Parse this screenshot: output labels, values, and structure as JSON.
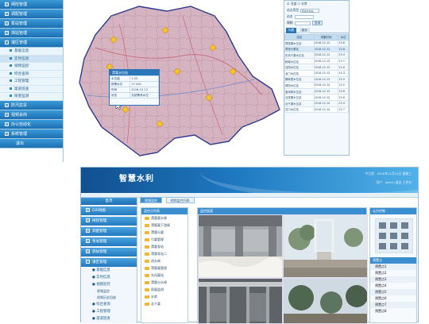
{
  "sidebar_top": {
    "items": [
      {
        "label": "闸控管理",
        "expanded": false
      },
      {
        "label": "调配管理",
        "expanded": false
      },
      {
        "label": "泵站管理",
        "expanded": false
      },
      {
        "label": "测站管理",
        "expanded": false
      },
      {
        "label": "灌区管理",
        "expanded": true
      }
    ],
    "subitems": [
      {
        "label": "基础信息",
        "selected": false
      },
      {
        "label": "实时信息",
        "selected": true
      },
      {
        "label": "视频监控",
        "selected": false
      },
      {
        "label": "综合查询",
        "selected": false
      },
      {
        "label": "工程管理",
        "selected": false
      },
      {
        "label": "渠道巡查",
        "selected": false
      },
      {
        "label": "隐患监测",
        "selected": false
      }
    ],
    "items_after": [
      {
        "label": "防汛抗旱"
      },
      {
        "label": "视频会商"
      },
      {
        "label": "办公自动化"
      },
      {
        "label": "系统管理"
      }
    ],
    "footer": "退出"
  },
  "map_popup": {
    "title": "渭惠水位站",
    "rows": [
      [
        "水位值",
        "1.25"
      ],
      [
        "报警水位",
        "17.200"
      ],
      [
        "时间",
        "2016-12-12"
      ],
      [
        "状态",
        "无超警戒水位"
      ]
    ]
  },
  "query_panel": {
    "checkbox_a": "河道",
    "checkbox_b": "水库",
    "row1_label": "站点类型",
    "row1_value": "河道水位站",
    "row2_label": "站名",
    "row2_value": "",
    "row3_label": "模糊",
    "button_search": "查询",
    "tabs": [
      "列表",
      "统计"
    ],
    "columns": [
      "站名",
      "采集时间",
      "水位"
    ],
    "rows": [
      [
        "渭惠渠水位站",
        "2016-12-12",
        "15.6"
      ],
      [
        "渭惠分渠站",
        "2016-12-12",
        "15.8"
      ],
      [
        "东风干渠水位站",
        "2016-12-12",
        "15.4"
      ],
      [
        "韩城水位站",
        "2016-12-12",
        "15.7"
      ],
      [
        "泾阳水位站",
        "2016-12-12",
        "15.6"
      ],
      [
        "龙门水位站",
        "2016-12-12",
        "15.3"
      ],
      [
        "魏家堡水位站",
        "2016-12-12",
        "15.9"
      ],
      [
        "咸阳水位站",
        "2016-12-12",
        "15.5"
      ],
      [
        "宝鸡峡水位站",
        "2016-12-12",
        "15.6"
      ],
      [
        "泾惠渠水位站",
        "2016-12-12",
        "15.8"
      ],
      [
        "北干渠水位站",
        "2016-12-12",
        "15.4"
      ],
      [
        "交口水位站",
        "2016-12-12",
        "15.7"
      ]
    ]
  },
  "app2": {
    "title": "智慧水利",
    "meta1": "今日是：2016年11月22日 星期三",
    "meta2": "用户：admin   退出   工作台",
    "nav_title": "首页",
    "nav_items": [
      {
        "label": "GIS地图"
      },
      {
        "label": "闸控管理"
      },
      {
        "label": "调配管理"
      },
      {
        "label": "泵站管理"
      },
      {
        "label": "测站管理"
      },
      {
        "label": "灌区管理",
        "expanded": true
      }
    ],
    "nav_subitems": [
      "基础信息",
      "实时信息",
      "视频监控"
    ],
    "nav_leaf": [
      "视频监控",
      "视频历史回放"
    ],
    "nav_items_after": [
      {
        "label": "综合查询"
      },
      {
        "label": "工程管理"
      },
      {
        "label": "渠道巡查"
      }
    ],
    "content_tabs": [
      "视频监控",
      "视频监控列表"
    ],
    "tree_title": "监控点列表",
    "tree_nodes": [
      "渭惠渠水闸",
      "渭惠渠下游闸",
      "渭惠分渠",
      "引渠管理",
      "渭惠泵站",
      "渭惠泵站二",
      "进水闸",
      "渭惠渠管理",
      "东风渠站",
      "渭惠分水闸",
      "雨量监测",
      "水库",
      "北干渠"
    ],
    "video_title": "监控画面",
    "ptz_title": "云台控制",
    "preset_title": "预置点",
    "presets": [
      "预置点1",
      "预置点2",
      "预置点3",
      "预置点4",
      "预置点5",
      "预置点6",
      "预置点7",
      "预置点8"
    ]
  },
  "colors": {
    "primary": "#1f6eb0",
    "accent": "#3b8fd0",
    "map_fill": "#cfaab8",
    "map_border": "#2b3a8f",
    "station_marker": "#f4c430"
  }
}
